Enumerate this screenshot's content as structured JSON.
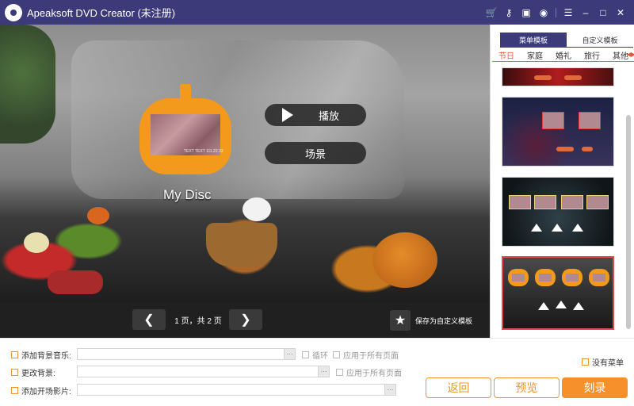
{
  "titlebar": {
    "title": "Apeaksoft DVD Creator (未注册)",
    "icons": [
      "cart-icon",
      "key-icon",
      "save-icon",
      "chat-icon",
      "menu-icon",
      "minimize-icon",
      "maximize-icon",
      "close-icon"
    ]
  },
  "preview": {
    "disc_title": "My Disc",
    "thumb_text": "TEXT TEXT 111.22.33",
    "play_label": "播放",
    "scene_label": "场景"
  },
  "pager": {
    "info": "1 页，共 2 页",
    "save_template": "保存为自定义模板"
  },
  "right_panel": {
    "tabs": [
      {
        "label": "菜单模板",
        "active": true
      },
      {
        "label": "自定义模板",
        "active": false
      }
    ],
    "categories": [
      {
        "label": "节日",
        "active": true
      },
      {
        "label": "家庭",
        "active": false
      },
      {
        "label": "婚礼",
        "active": false
      },
      {
        "label": "旅行",
        "active": false
      },
      {
        "label": "其他",
        "active": false
      }
    ],
    "selected_template_index": 3
  },
  "bottom": {
    "bg_music_label": "添加背景音乐:",
    "loop_label": "循环",
    "apply_all_label": "应用于所有页面",
    "change_bg_label": "更改背景:",
    "apply_all_label2": "应用于所有页面",
    "opening_label": "添加开场影片:",
    "no_menu_label": "没有菜单",
    "back_button": "返回",
    "preview_button": "预览",
    "burn_button": "刻录"
  },
  "colors": {
    "titlebar": "#3c3a78",
    "accent": "#f5902a",
    "selected_border": "#e24b4b"
  }
}
